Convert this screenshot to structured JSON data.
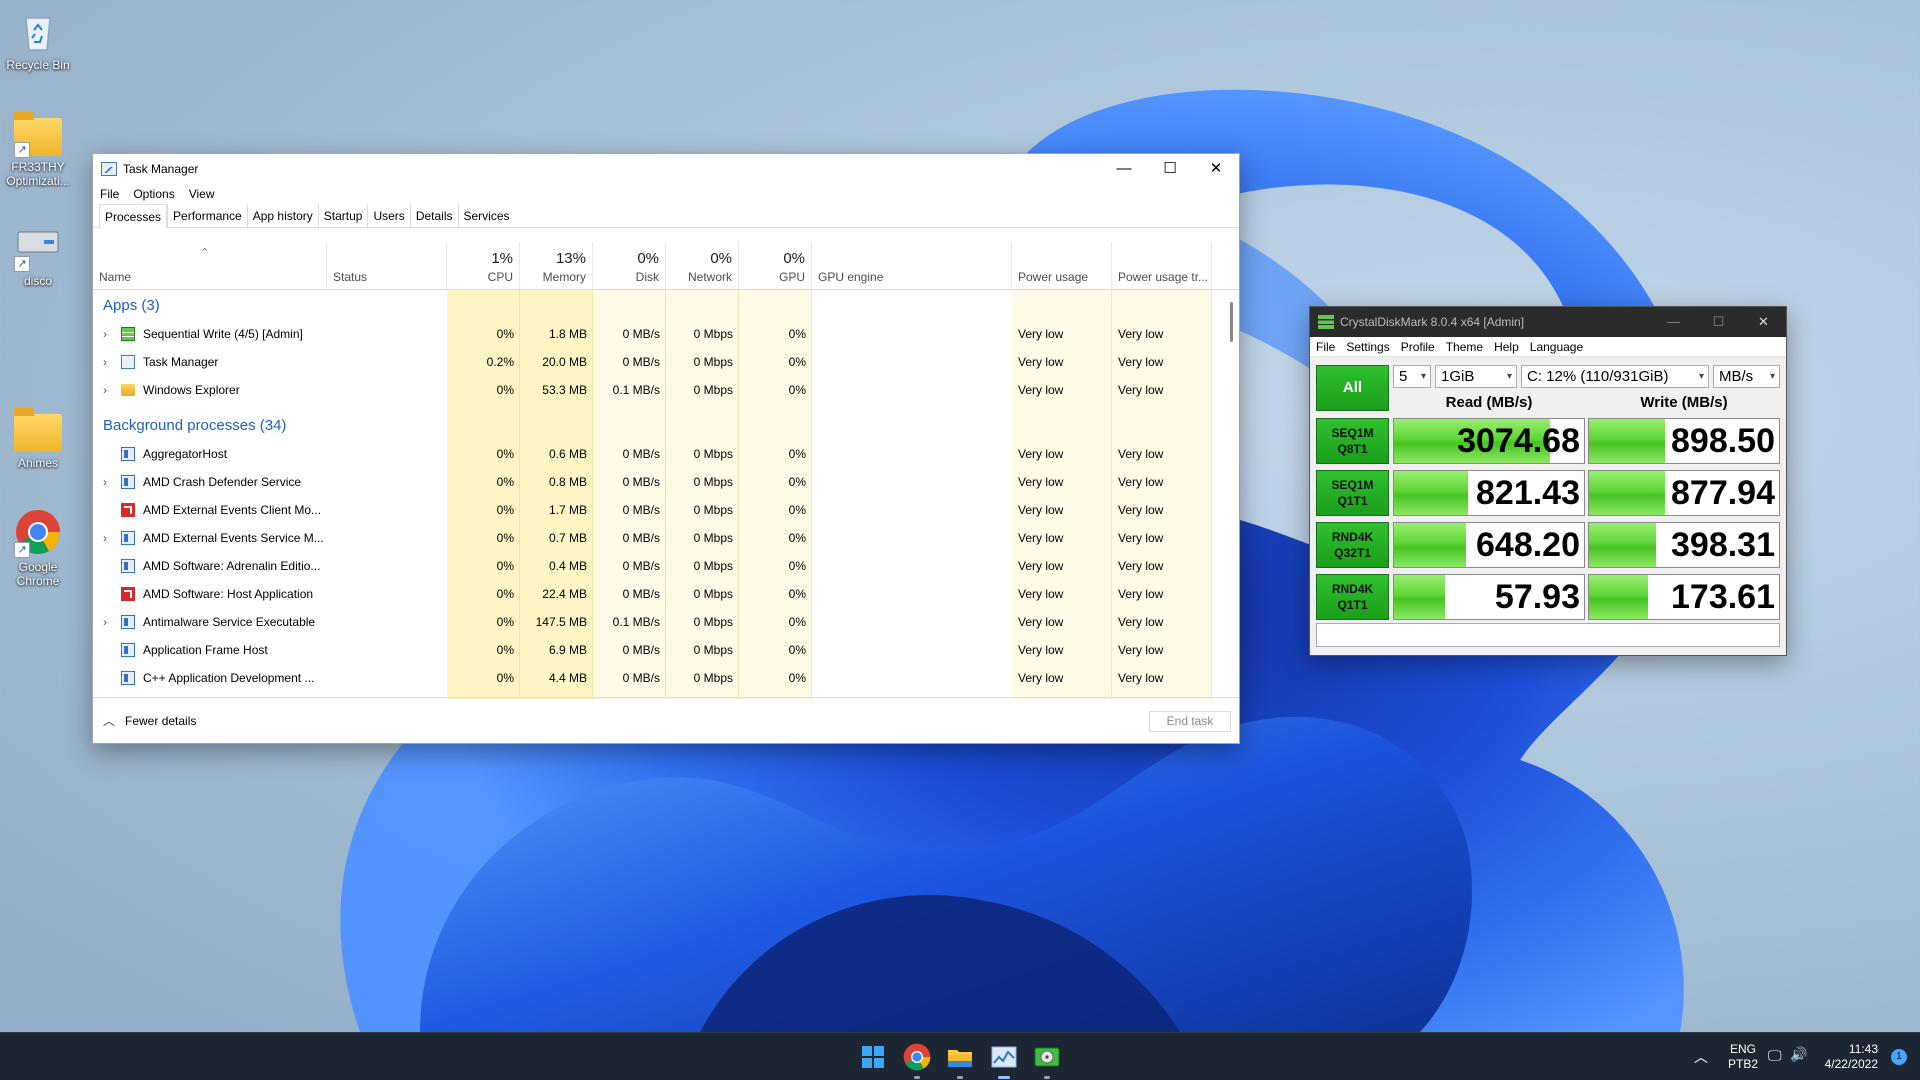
{
  "desktop": {
    "icons": [
      {
        "label": "Recycle Bin"
      },
      {
        "label": "FR33THY Optimizati..."
      },
      {
        "label": "disco"
      },
      {
        "label": "Animes"
      },
      {
        "label": "Google Chrome"
      }
    ]
  },
  "task_manager": {
    "title": "Task Manager",
    "caption": {
      "minimize": "—",
      "maximize": "☐",
      "close": "✕"
    },
    "menu": [
      "File",
      "Options",
      "View"
    ],
    "tabs": [
      "Processes",
      "Performance",
      "App history",
      "Startup",
      "Users",
      "Details",
      "Services"
    ],
    "active_tab": "Processes",
    "columns": {
      "name": "Name",
      "status": "Status",
      "cpu": {
        "label": "CPU",
        "pct": "1%"
      },
      "memory": {
        "label": "Memory",
        "pct": "13%"
      },
      "disk": {
        "label": "Disk",
        "pct": "0%"
      },
      "network": {
        "label": "Network",
        "pct": "0%"
      },
      "gpu": {
        "label": "GPU",
        "pct": "0%"
      },
      "gpu_engine": "GPU engine",
      "power": "Power usage",
      "power_trend": "Power usage tr..."
    },
    "sections": {
      "apps": "Apps (3)",
      "background": "Background processes (34)"
    },
    "apps": [
      {
        "name": "Sequential Write (4/5) [Admin]",
        "icon": "cdm",
        "expand": true,
        "cpu": "0%",
        "memory": "1.8 MB",
        "disk": "0 MB/s",
        "network": "0 Mbps",
        "gpu": "0%",
        "power": "Very low",
        "power_trend": "Very low"
      },
      {
        "name": "Task Manager",
        "icon": "tmi",
        "expand": true,
        "cpu": "0.2%",
        "memory": "20.0 MB",
        "disk": "0 MB/s",
        "network": "0 Mbps",
        "gpu": "0%",
        "power": "Very low",
        "power_trend": "Very low"
      },
      {
        "name": "Windows Explorer",
        "icon": "folder",
        "expand": true,
        "cpu": "0%",
        "memory": "53.3 MB",
        "disk": "0.1 MB/s",
        "network": "0 Mbps",
        "gpu": "0%",
        "power": "Very low",
        "power_trend": "Very low"
      }
    ],
    "background": [
      {
        "name": "AggregatorHost",
        "icon": "blue",
        "expand": false,
        "cpu": "0%",
        "memory": "0.6 MB",
        "disk": "0 MB/s",
        "network": "0 Mbps",
        "gpu": "0%",
        "power": "Very low",
        "power_trend": "Very low"
      },
      {
        "name": "AMD Crash Defender Service",
        "icon": "blue",
        "expand": true,
        "cpu": "0%",
        "memory": "0.8 MB",
        "disk": "0 MB/s",
        "network": "0 Mbps",
        "gpu": "0%",
        "power": "Very low",
        "power_trend": "Very low"
      },
      {
        "name": "AMD External Events Client Mo...",
        "icon": "amd",
        "expand": false,
        "cpu": "0%",
        "memory": "1.7 MB",
        "disk": "0 MB/s",
        "network": "0 Mbps",
        "gpu": "0%",
        "power": "Very low",
        "power_trend": "Very low"
      },
      {
        "name": "AMD External Events Service M...",
        "icon": "blue",
        "expand": true,
        "cpu": "0%",
        "memory": "0.7 MB",
        "disk": "0 MB/s",
        "network": "0 Mbps",
        "gpu": "0%",
        "power": "Very low",
        "power_trend": "Very low"
      },
      {
        "name": "AMD Software: Adrenalin Editio...",
        "icon": "blue",
        "expand": false,
        "cpu": "0%",
        "memory": "0.4 MB",
        "disk": "0 MB/s",
        "network": "0 Mbps",
        "gpu": "0%",
        "power": "Very low",
        "power_trend": "Very low"
      },
      {
        "name": "AMD Software: Host Application",
        "icon": "amd",
        "expand": false,
        "cpu": "0%",
        "memory": "22.4 MB",
        "disk": "0 MB/s",
        "network": "0 Mbps",
        "gpu": "0%",
        "power": "Very low",
        "power_trend": "Very low"
      },
      {
        "name": "Antimalware Service Executable",
        "icon": "blue",
        "expand": true,
        "cpu": "0%",
        "memory": "147.5 MB",
        "disk": "0.1 MB/s",
        "network": "0 Mbps",
        "gpu": "0%",
        "power": "Very low",
        "power_trend": "Very low"
      },
      {
        "name": "Application Frame Host",
        "icon": "blue",
        "expand": false,
        "cpu": "0%",
        "memory": "6.9 MB",
        "disk": "0 MB/s",
        "network": "0 Mbps",
        "gpu": "0%",
        "power": "Very low",
        "power_trend": "Very low"
      },
      {
        "name": "C++ Application Development ...",
        "icon": "blue",
        "expand": false,
        "cpu": "0%",
        "memory": "4.4 MB",
        "disk": "0 MB/s",
        "network": "0 Mbps",
        "gpu": "0%",
        "power": "Very low",
        "power_trend": "Very low"
      }
    ],
    "footer": {
      "fewer_details": "Fewer details",
      "end_task": "End task"
    }
  },
  "crystaldiskmark": {
    "title": "CrystalDiskMark 8.0.4 x64 [Admin]",
    "caption": {
      "minimize": "—",
      "maximize": "☐",
      "close": "✕"
    },
    "menu": [
      "File",
      "Settings",
      "Profile",
      "Theme",
      "Help",
      "Language"
    ],
    "controls": {
      "count": "5",
      "size": "1GiB",
      "drive": "C: 12% (110/931GiB)",
      "unit": "MB/s"
    },
    "all_button": "All",
    "read_header": "Read (MB/s)",
    "write_header": "Write (MB/s)",
    "max_scale": 3500,
    "tests": [
      {
        "line1": "SEQ1M",
        "line2": "Q8T1",
        "read": "3074.68",
        "write": "898.50",
        "read_level": 0.82,
        "write_level": 0.4
      },
      {
        "line1": "SEQ1M",
        "line2": "Q1T1",
        "read": "821.43",
        "write": "877.94",
        "read_level": 0.39,
        "write_level": 0.4
      },
      {
        "line1": "RND4K",
        "line2": "Q32T1",
        "read": "648.20",
        "write": "398.31",
        "read_level": 0.38,
        "write_level": 0.35
      },
      {
        "line1": "RND4K",
        "line2": "Q1T1",
        "read": "57.93",
        "write": "173.61",
        "read_level": 0.27,
        "write_level": 0.31
      }
    ]
  },
  "taskbar": {
    "apps": [
      {
        "icon": "windows-start-icon"
      },
      {
        "icon": "chrome-icon"
      },
      {
        "icon": "file-explorer-icon"
      },
      {
        "icon": "task-manager-icon"
      },
      {
        "icon": "crystaldiskmark-icon"
      }
    ],
    "tray": {
      "lang_top": "ENG",
      "lang_bottom": "PTB2",
      "time": "11:43",
      "date": "4/22/2022",
      "notifications": "1"
    }
  }
}
